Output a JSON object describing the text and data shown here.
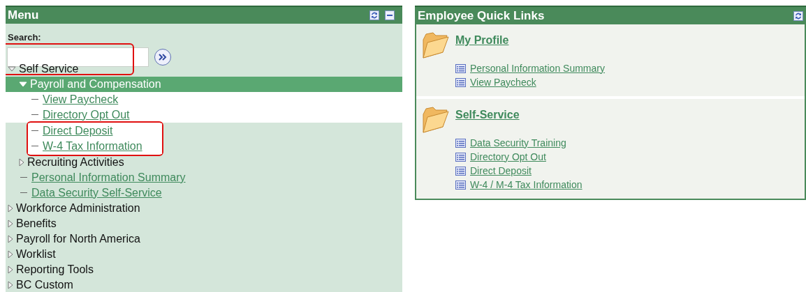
{
  "menu": {
    "title": "Menu",
    "search": {
      "label": "Search:"
    },
    "tree": [
      {
        "label": "Self Service",
        "kind": "folder",
        "expanded": true,
        "selected": false,
        "highlighted": true,
        "children": [
          {
            "label": "Payroll and Compensation",
            "kind": "folder",
            "expanded": true,
            "selected": true,
            "highlighted": false,
            "children": [
              {
                "label": "View Paycheck",
                "kind": "link",
                "selected": false,
                "highlighted": false
              },
              {
                "label": "Directory Opt Out",
                "kind": "link",
                "selected": false,
                "highlighted": false
              },
              {
                "label": "Direct Deposit",
                "kind": "link",
                "selected": false,
                "highlighted": true
              },
              {
                "label": "W-4 Tax Information",
                "kind": "link",
                "selected": false,
                "highlighted": true
              }
            ]
          },
          {
            "label": "Recruiting Activities",
            "kind": "folder",
            "expanded": false,
            "selected": false,
            "highlighted": false
          },
          {
            "label": "Personal Information Summary",
            "kind": "link",
            "selected": false,
            "highlighted": false
          },
          {
            "label": "Data Security Self-Service",
            "kind": "link",
            "selected": false,
            "highlighted": false
          }
        ]
      },
      {
        "label": "Workforce Administration",
        "kind": "folder",
        "expanded": false,
        "selected": false,
        "highlighted": false
      },
      {
        "label": "Benefits",
        "kind": "folder",
        "expanded": false,
        "selected": false,
        "highlighted": false
      },
      {
        "label": "Payroll for North America",
        "kind": "folder",
        "expanded": false,
        "selected": false,
        "highlighted": false
      },
      {
        "label": "Worklist",
        "kind": "folder",
        "expanded": false,
        "selected": false,
        "highlighted": false
      },
      {
        "label": "Reporting Tools",
        "kind": "folder",
        "expanded": false,
        "selected": false,
        "highlighted": false
      },
      {
        "label": "BC Custom",
        "kind": "folder",
        "expanded": false,
        "selected": false,
        "highlighted": false
      }
    ]
  },
  "quick_links": {
    "title": "Employee Quick Links",
    "sections": [
      {
        "title": "My Profile",
        "links": [
          "Personal Information Summary",
          "View Paycheck"
        ]
      },
      {
        "title": "Self-Service",
        "links": [
          "Data Security Training",
          "Directory Opt Out",
          "Direct Deposit",
          "W-4 / M-4 Tax Information"
        ]
      }
    ]
  }
}
